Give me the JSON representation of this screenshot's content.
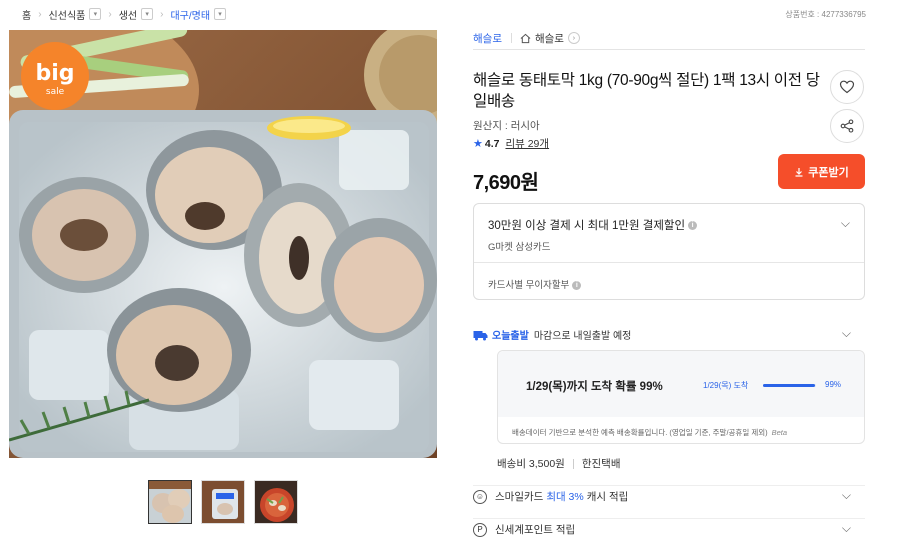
{
  "breadcrumb": {
    "items": [
      "홈",
      "신선식품",
      "생선",
      "대구/명태"
    ]
  },
  "product_number": "상품번호 : 4277336795",
  "seller": {
    "name": "해슬로",
    "store_name": "해슬로"
  },
  "image": {
    "badge_line1": "big",
    "badge_line2": "sale"
  },
  "product": {
    "title": "해슬로 동태토막 1kg (70-90g씩 절단) 1팩 13시 이전 당일배송",
    "origin": "원산지 : 러시아",
    "rating": "4.7",
    "reviews": "리뷰 29개",
    "price": "7,690원"
  },
  "buttons": {
    "coupon": "쿠폰받기"
  },
  "benefits": {
    "card_discount": "30만원 이상 결제 시 최대 1만원 결제할인",
    "card_name": "G마켓 삼성카드",
    "installment": "카드사별 무이자할부"
  },
  "delivery": {
    "tag": "오늘출발",
    "text": "마감으로 내일출발 예정",
    "eta": "1/29(목)까지 도착 확률 99%",
    "eta_short": "1/29(목) 도착",
    "probability": 0.99,
    "probability_label": "99%",
    "note": "배송데이터 기반으로 분석한 예측 배송확률입니다. (영업일 기준, 주말/공휴일 제외)",
    "beta": "Beta"
  },
  "shipping": {
    "fee": "배송비 3,500원",
    "carrier": "한진택배"
  },
  "rewards": {
    "smile_prefix": "스마일카드",
    "smile_highlight": "최대 3%",
    "smile_suffix": "캐시 적립",
    "shinsegae": "신세계포인트 적립"
  },
  "colors": {
    "accent": "#2a63e8",
    "coupon": "#f54e2a",
    "badge": "#f5842a"
  }
}
